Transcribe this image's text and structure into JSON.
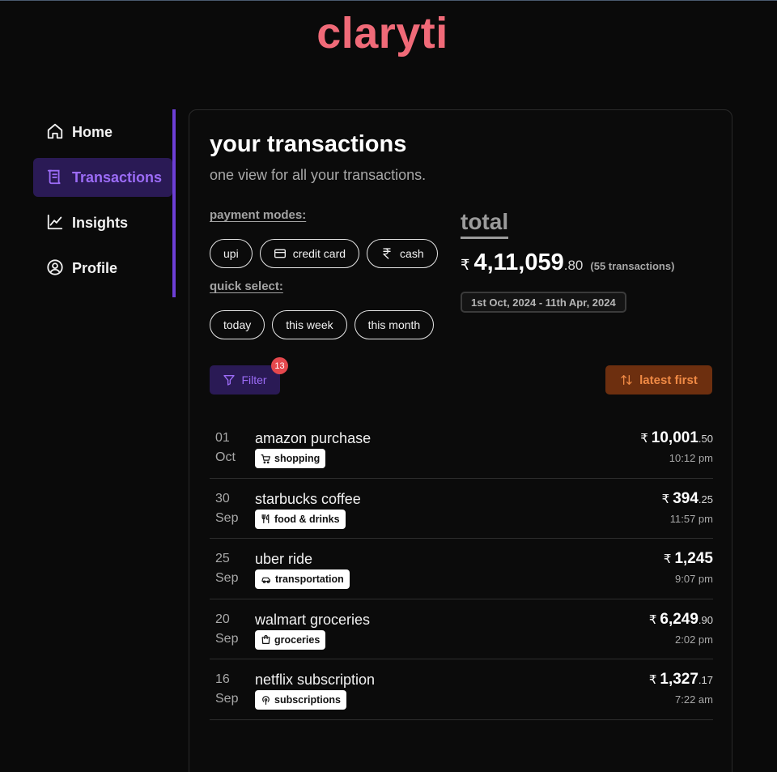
{
  "brand": {
    "name": "claryti",
    "color": "#f06a78"
  },
  "sidebar": {
    "items": [
      {
        "label": "Home",
        "icon": "home-icon",
        "active": false
      },
      {
        "label": "Transactions",
        "icon": "receipt-icon",
        "active": true
      },
      {
        "label": "Insights",
        "icon": "line-chart-icon",
        "active": false
      },
      {
        "label": "Profile",
        "icon": "user-circle-icon",
        "active": false
      }
    ]
  },
  "main": {
    "title": "your transactions",
    "subtitle": "one view for all your transactions.",
    "payment_modes_label": "payment modes:",
    "payment_modes": [
      {
        "label": "upi",
        "icon": ""
      },
      {
        "label": "credit card",
        "icon": "credit-card-icon"
      },
      {
        "label": "cash",
        "icon": "rupee-icon"
      }
    ],
    "quick_select_label": "quick select:",
    "quick_select": [
      "today",
      "this week",
      "this month"
    ],
    "total": {
      "label": "total",
      "currency": "₹",
      "amount_main": "4,11,059",
      "amount_decimal": ".80",
      "count": "(55 transactions)",
      "date_range": "1st Oct, 2024 - 11th Apr, 2024"
    },
    "filter": {
      "label": "Filter",
      "badge": "13"
    },
    "sort": {
      "label": "latest first"
    },
    "transactions": [
      {
        "day": "01",
        "month": "Oct",
        "name": "amazon purchase",
        "category": "shopping",
        "cat_icon": "cart-icon",
        "currency": "₹",
        "amount_main": "10,001",
        "amount_decimal": ".50",
        "time": "10:12 pm"
      },
      {
        "day": "30",
        "month": "Sep",
        "name": "starbucks coffee",
        "category": "food & drinks",
        "cat_icon": "utensils-icon",
        "currency": "₹",
        "amount_main": "394",
        "amount_decimal": ".25",
        "time": "11:57 pm"
      },
      {
        "day": "25",
        "month": "Sep",
        "name": "uber ride",
        "category": "transportation",
        "cat_icon": "car-icon",
        "currency": "₹",
        "amount_main": "1,245",
        "amount_decimal": "",
        "time": "9:07 pm"
      },
      {
        "day": "20",
        "month": "Sep",
        "name": "walmart groceries",
        "category": "groceries",
        "cat_icon": "shopping-bag-icon",
        "currency": "₹",
        "amount_main": "6,249",
        "amount_decimal": ".90",
        "time": "2:02 pm"
      },
      {
        "day": "16",
        "month": "Sep",
        "name": "netflix subscription",
        "category": "subscriptions",
        "cat_icon": "podcast-icon",
        "currency": "₹",
        "amount_main": "1,327",
        "amount_decimal": ".17",
        "time": "7:22 am"
      }
    ]
  }
}
